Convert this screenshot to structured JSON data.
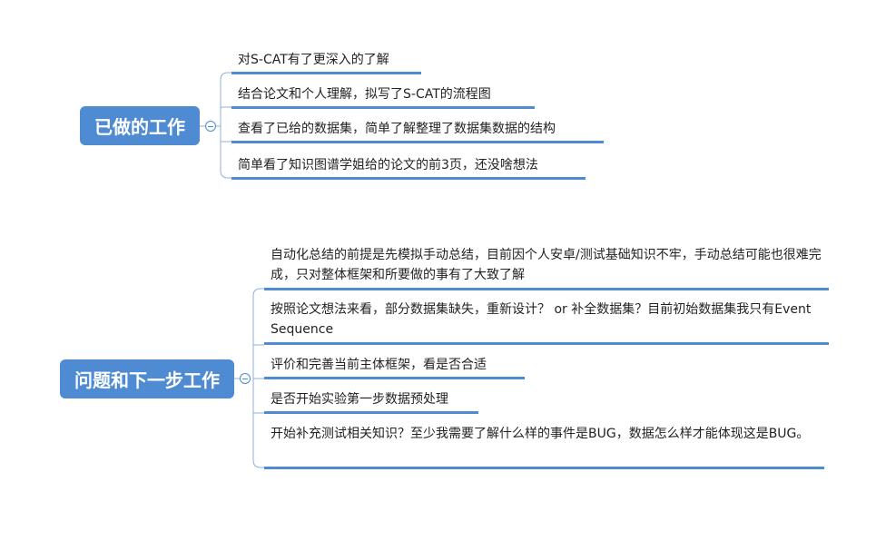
{
  "mindmap": {
    "done": {
      "title": "已做的工作",
      "items": [
        "对S-CAT有了更深入的了解",
        "结合论文和个人理解，拟写了S-CAT的流程图",
        "查看了已给的数据集，简单了解整理了数据集数据的结构",
        "简单看了知识图谱学姐给的论文的前3页，还没啥想法"
      ]
    },
    "next": {
      "title": "问题和下一步工作",
      "items": [
        "自动化总结的前提是先模拟手动总结，目前因个人安卓/测试基础知识不牢，手动总结可能也很难完成，只对整体框架和所要做的事有了大致了解",
        "按照论文想法来看，部分数据集缺失，重新设计？ or 补全数据集？目前初始数据集我只有Event Sequence",
        "评价和完善当前主体框架，看是否合适",
        "是否开始实验第一步数据预处理",
        "开始补充测试相关知识？至少我需要了解什么样的事件是BUG，数据怎么样才能体现这是BUG。"
      ]
    }
  },
  "colors": {
    "accent": "#4e8bd3",
    "line": "#9db8de"
  }
}
